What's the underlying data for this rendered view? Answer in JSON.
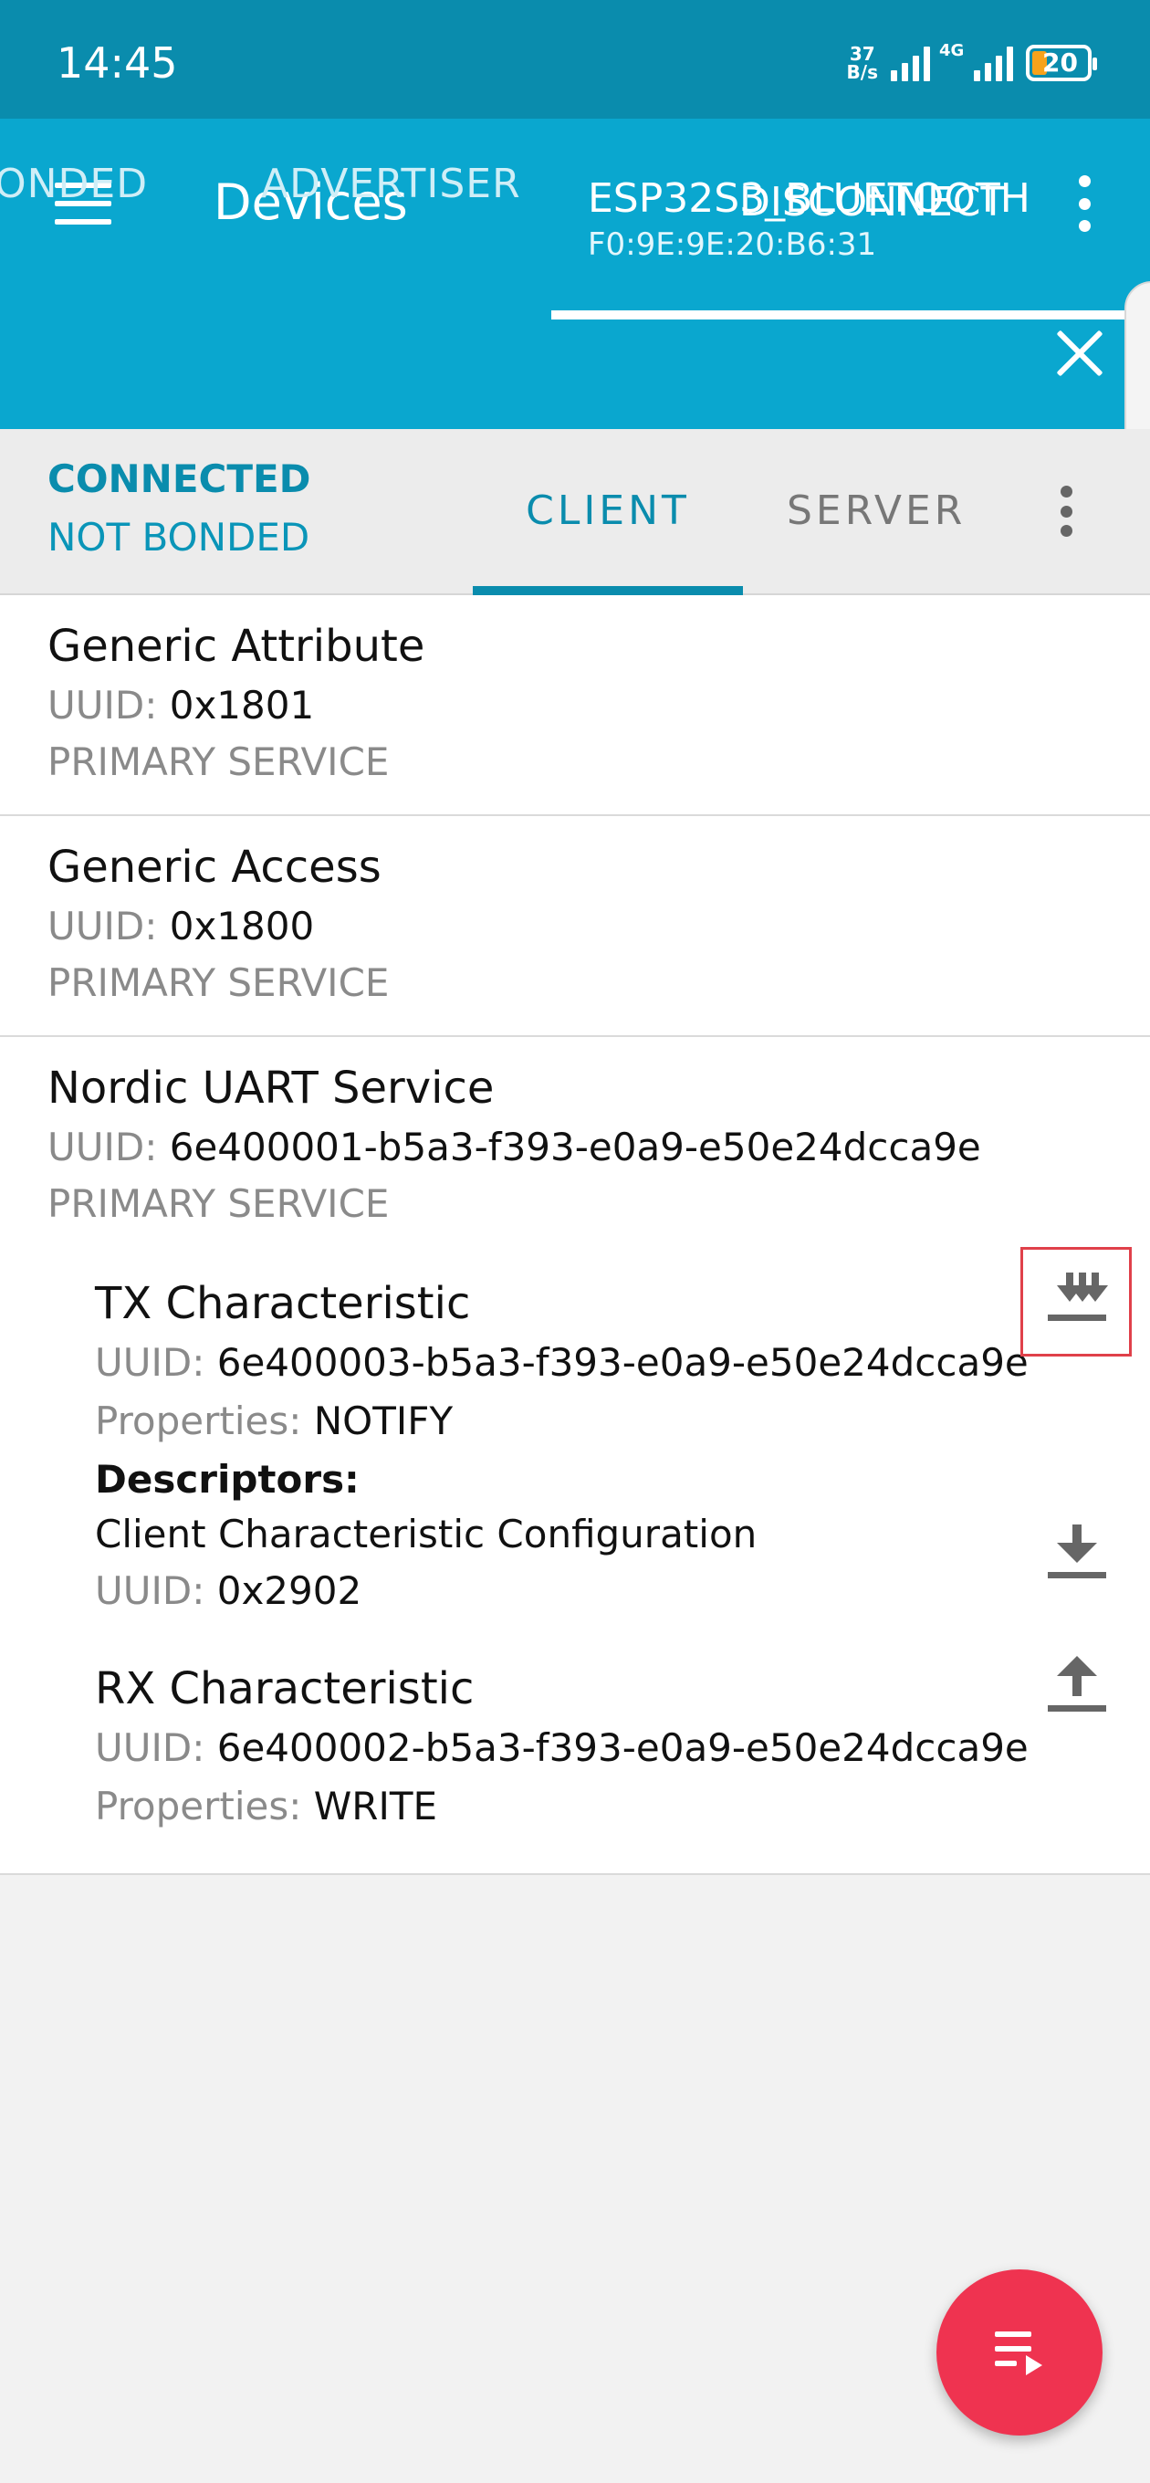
{
  "status_bar": {
    "time": "14:45",
    "net_speed_value": "37",
    "net_speed_unit": "B/s",
    "network_type": "4G",
    "battery_percent": "20"
  },
  "app_bar": {
    "title": "Devices",
    "disconnect_label": "DISCONNECT"
  },
  "device_tabs": {
    "bonded_label": "ONDED",
    "advertiser_label": "ADVERTISER",
    "active_device_name": "ESP32S3_BLUETOOTH",
    "active_device_mac": "F0:9E:9E:20:B6:31"
  },
  "connection": {
    "status": "CONNECTED",
    "bond_status": "NOT BONDED",
    "tab_client": "CLIENT",
    "tab_server": "SERVER"
  },
  "labels": {
    "uuid": "UUID:",
    "properties": "Properties:",
    "descriptors": "Descriptors:"
  },
  "services": [
    {
      "name": "Generic Attribute",
      "uuid": "0x1801",
      "type": "PRIMARY SERVICE"
    },
    {
      "name": "Generic Access",
      "uuid": "0x1800",
      "type": "PRIMARY SERVICE"
    },
    {
      "name": "Nordic UART Service",
      "uuid": "6e400001-b5a3-f393-e0a9-e50e24dcca9e",
      "type": "PRIMARY SERVICE"
    }
  ],
  "characteristics": [
    {
      "name": "TX Characteristic",
      "uuid": "6e400003-b5a3-f393-e0a9-e50e24dcca9e",
      "properties": "NOTIFY",
      "descriptor": {
        "name": "Client Characteristic Configuration",
        "uuid": "0x2902"
      }
    },
    {
      "name": "RX Characteristic",
      "uuid": "6e400002-b5a3-f393-e0a9-e50e24dcca9e",
      "properties": "WRITE"
    }
  ],
  "colors": {
    "status_bar": "#0a8cad",
    "app_bar": "#0aa7cf",
    "accent": "#0a8cad",
    "fab": "#ef3350",
    "highlight": "#e0404a"
  },
  "icons": {
    "menu": "hamburger-menu-icon",
    "overflow": "more-vert-icon",
    "close": "close-icon",
    "notify": "notify-download-multiple-icon",
    "read": "download-icon",
    "write": "upload-icon",
    "fab": "log-list-icon"
  }
}
